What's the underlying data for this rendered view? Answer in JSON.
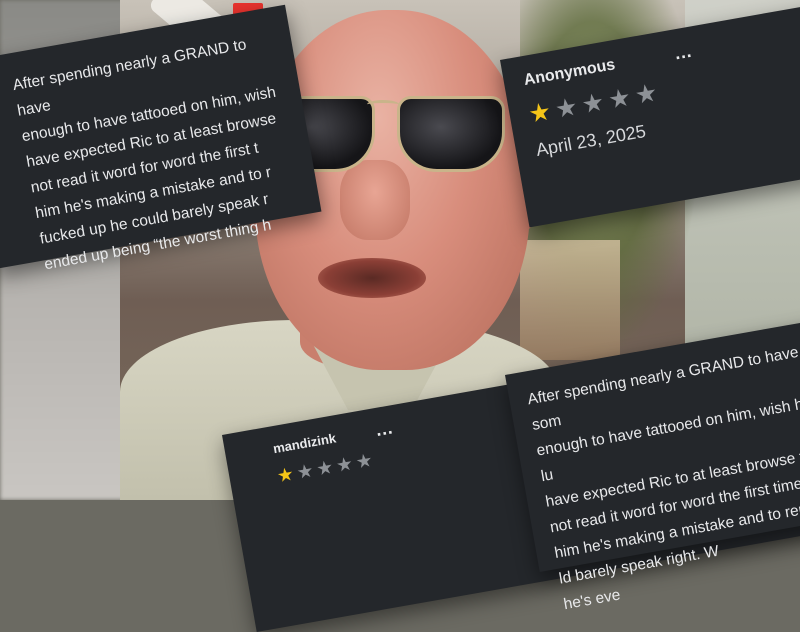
{
  "reviews": {
    "left_text": "After spending nearly a GRAND to have\nenough to have tattooed on him, wish\nhave expected Ric to at least browse\nnot read it word for word the first t\nhim he's making a mistake and to r\nfucked up he could barely speak r\nended up being “the worst thing h",
    "top": {
      "reviewer": "Anonymous",
      "more": "…",
      "rating": 1,
      "max_rating": 5,
      "date": "April 23, 2025"
    },
    "bottom": {
      "reviewer": "mandizink",
      "more": "…",
      "rating": 1,
      "max_rating": 5
    },
    "right_text": "After spending nearly a GRAND to have som\nenough to have tattooed on him, wish him lu\nhave expected Ric to at least browse throu\nnot read it word for word the first time and\nhim he's making a mistake and to remain\nld barely speak right. W\nhe's eve"
  },
  "colors": {
    "card_bg": "#24272b",
    "star_on": "#f5c518",
    "star_off": "#8d9196"
  }
}
